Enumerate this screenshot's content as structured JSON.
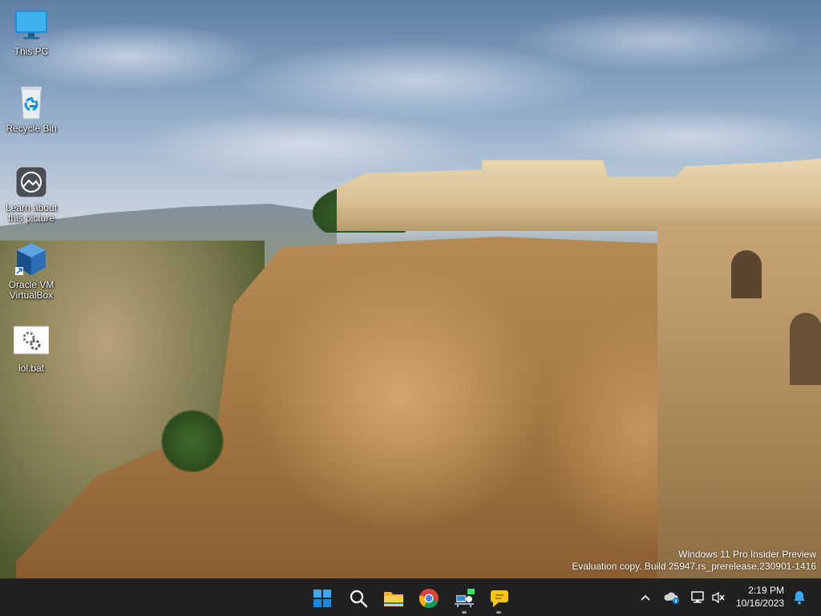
{
  "desktop": {
    "icons": [
      {
        "label": "This PC",
        "icon": "monitor-icon"
      },
      {
        "label": "Recycle Bin",
        "icon": "recycle-bin-icon"
      },
      {
        "label": "Learn about this picture",
        "icon": "camera-icon"
      },
      {
        "label": "Oracle VM VirtualBox",
        "icon": "virtualbox-icon"
      },
      {
        "label": "lol.bat",
        "icon": "batch-file-icon"
      }
    ],
    "watermark": {
      "line1": "Windows 11 Pro Insider Preview",
      "line2": "Evaluation copy. Build 25947.rs_prerelease.230901-1416"
    }
  },
  "taskbar": {
    "apps": [
      {
        "name": "Start",
        "icon": "windows-start-icon"
      },
      {
        "name": "Search",
        "icon": "search-icon"
      },
      {
        "name": "File Explorer",
        "icon": "folder-icon"
      },
      {
        "name": "Google Chrome",
        "icon": "chrome-icon"
      },
      {
        "name": "Network app",
        "icon": "network-app-icon"
      },
      {
        "name": "Chat app",
        "icon": "chat-bubble-icon"
      }
    ],
    "tray": {
      "overflow_icon": "chevron-up-icon",
      "icons": [
        "cloud-info-icon",
        "network-monitor-icon",
        "speaker-muted-icon"
      ],
      "notification_icon": "bell-icon"
    },
    "clock": {
      "time": "2:19 PM",
      "date": "10/16/2023"
    }
  },
  "colors": {
    "taskbar_bg": "#202020",
    "accent": "#0078d4"
  }
}
